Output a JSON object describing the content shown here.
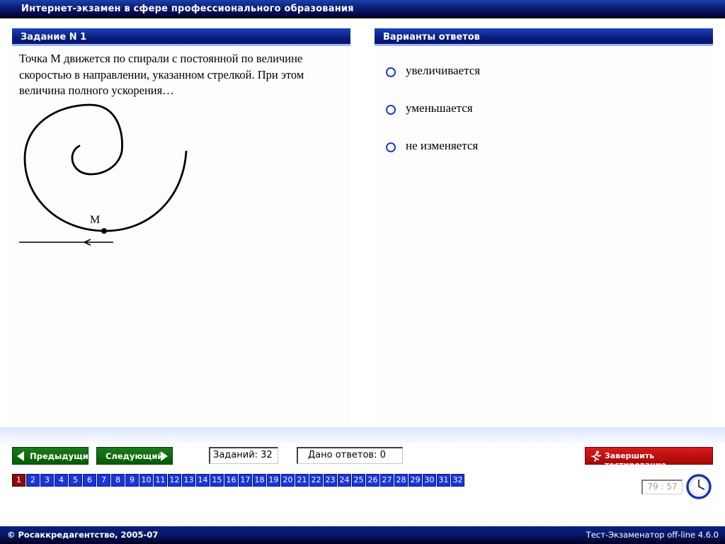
{
  "app": {
    "title": "Интернет-экзамен в сфере профессионального образования"
  },
  "question": {
    "heading": "Задание N 1",
    "text": "Точка М движется по спирали с постоянной по величине скоростью в направлении, указанном стрелкой. При этом величина полного ускорения…",
    "figure_point_label": "М"
  },
  "answers": {
    "heading": "Варианты ответов",
    "options": [
      {
        "label": "увеличивается"
      },
      {
        "label": "уменьшается"
      },
      {
        "label": "не изменяется"
      }
    ]
  },
  "nav": {
    "prev_label": "Предыдущий",
    "next_label": "Следующий",
    "tasks_count": "Заданий: 32",
    "answered_count": "Дано ответов: 0",
    "finish_label": "Завершить тестирование"
  },
  "pages": [
    "1",
    "2",
    "3",
    "4",
    "5",
    "6",
    "7",
    "8",
    "9",
    "10",
    "11",
    "12",
    "13",
    "14",
    "15",
    "16",
    "17",
    "18",
    "19",
    "20",
    "21",
    "22",
    "23",
    "24",
    "25",
    "26",
    "27",
    "28",
    "29",
    "30",
    "31",
    "32"
  ],
  "current_page": "1",
  "timer": "79 : 57",
  "footer": {
    "copyright": "© Росаккредагентство, 2005-07",
    "version": "Тест-Экзаменатор off-line 4.6.0"
  },
  "colors": {
    "title_bar": "#0a1e78",
    "nav_button": "#0b6a0b",
    "finish_button": "#c01010",
    "page_button": "#1a35d8",
    "page_button_active": "#8b0b0b"
  },
  "icons": {
    "prev": "triangle-left-icon",
    "next": "triangle-right-icon",
    "finish": "running-man-icon",
    "timer": "clock-icon"
  }
}
